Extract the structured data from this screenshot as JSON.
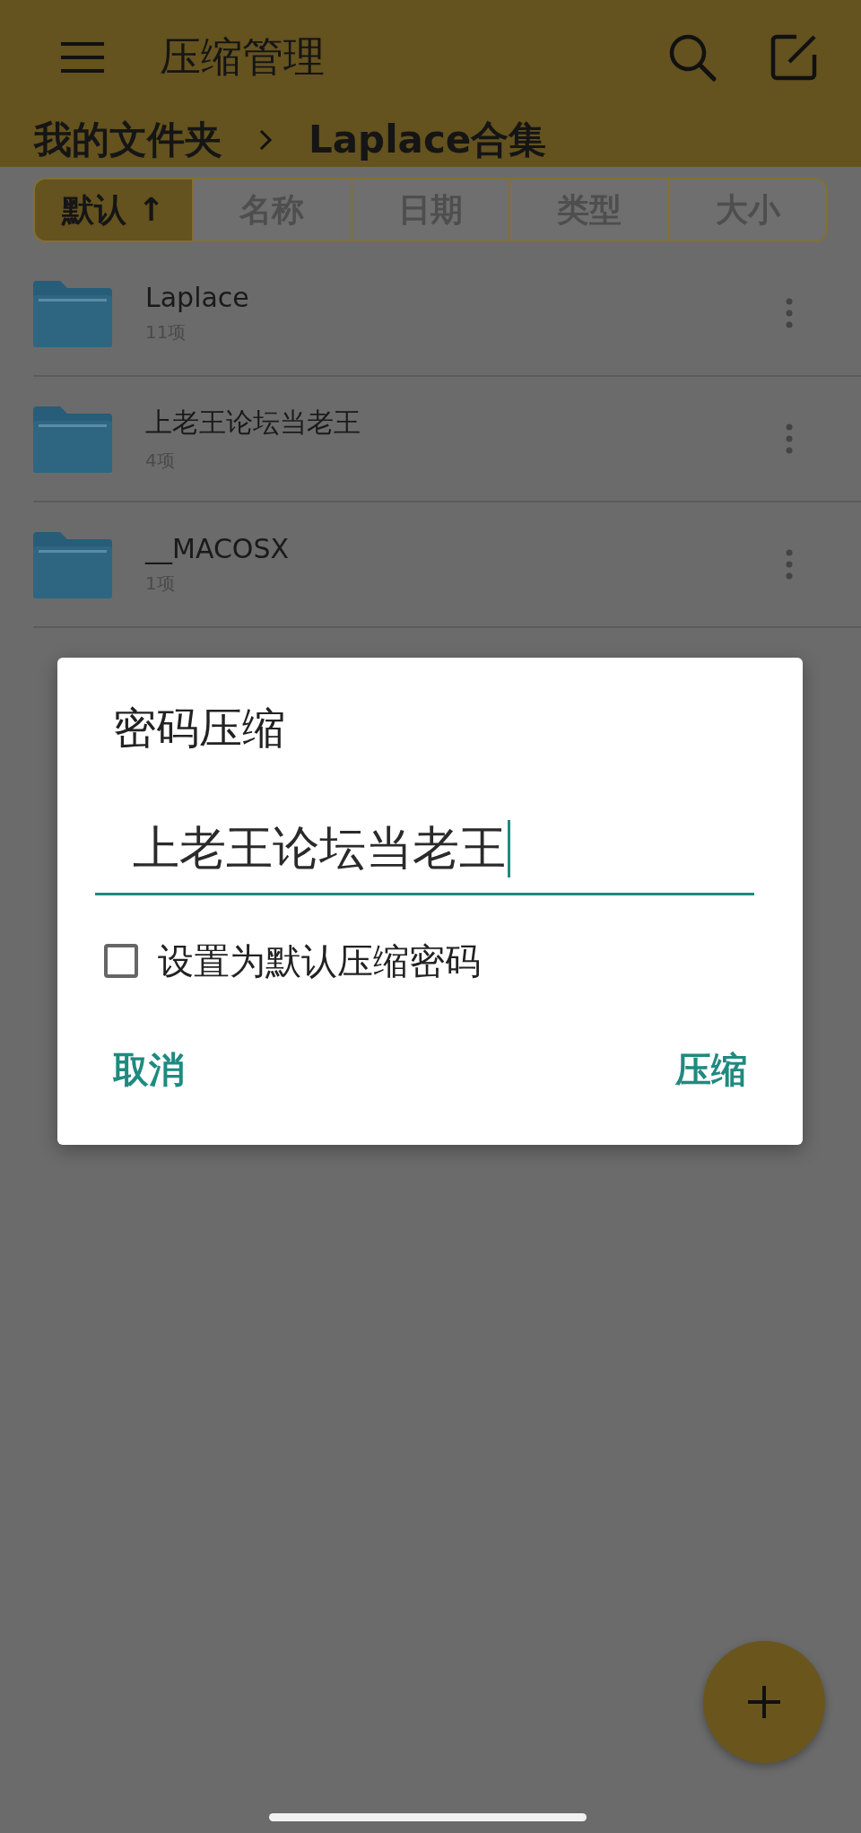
{
  "app_bar": {
    "title": "压缩管理"
  },
  "breadcrumb": [
    {
      "label": "我的文件夹"
    },
    {
      "label": "Laplace合集"
    }
  ],
  "sort_tabs": [
    {
      "label": "默认 ↑",
      "selected": true
    },
    {
      "label": "名称",
      "selected": false
    },
    {
      "label": "日期",
      "selected": false
    },
    {
      "label": "类型",
      "selected": false
    },
    {
      "label": "大小",
      "selected": false
    }
  ],
  "files": [
    {
      "name": "Laplace",
      "count": "11项"
    },
    {
      "name": "上老王论坛当老王",
      "count": "4项"
    },
    {
      "name": "__MACOSX",
      "count": "1项"
    }
  ],
  "dialog": {
    "title": "密码压缩",
    "password": {
      "value": "上老王论坛当老王",
      "focused": true
    },
    "checkbox": {
      "label": "设置为默认压缩密码",
      "checked": false
    },
    "buttons": [
      {
        "label": "取消"
      },
      {
        "label": "压缩"
      }
    ]
  }
}
